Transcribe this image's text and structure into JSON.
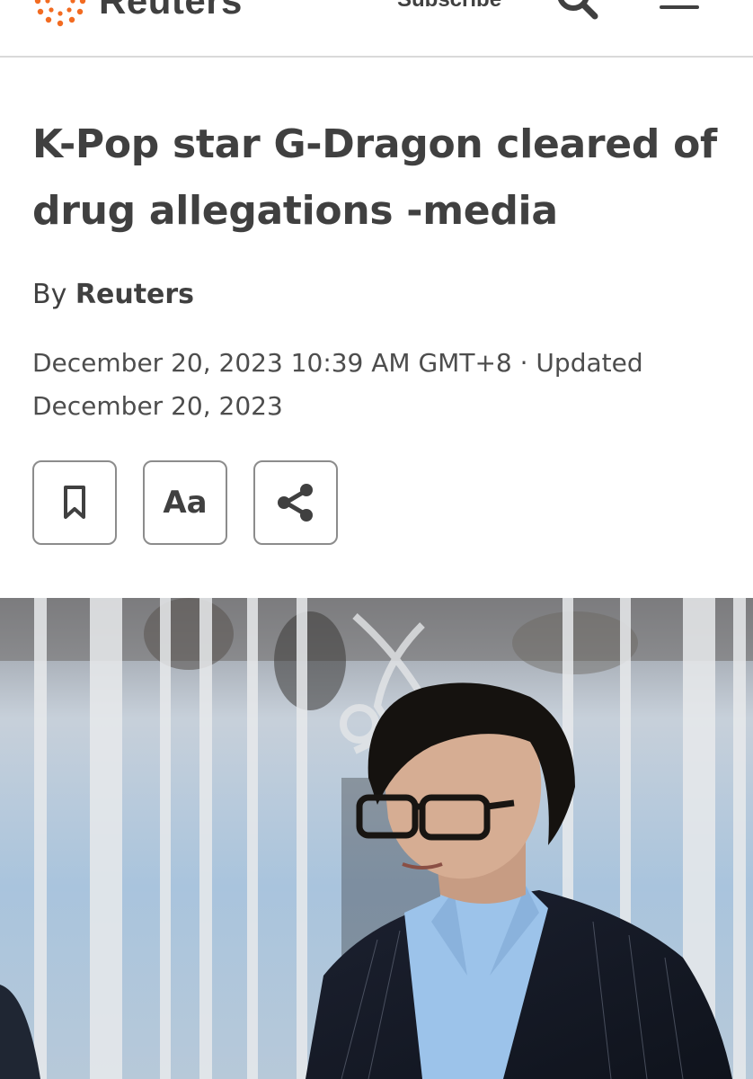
{
  "header": {
    "brand": "Reuters",
    "subscribe_label": "Subscribe",
    "icons": {
      "logo": "reuters-dots-logo",
      "search": "search-icon",
      "menu": "menu-icon"
    },
    "logo_color": "#f26b21"
  },
  "article": {
    "headline": "K-Pop star G-Dragon cleared of drug allegations -media",
    "byline_prefix": "By",
    "author": "Reuters",
    "dateline": "December 20, 2023 10:39 AM GMT+8 · Updated December 20, 2023",
    "actions": [
      {
        "icon": "bookmark-icon"
      },
      {
        "label": "Aa",
        "icon": "font-size-icon"
      },
      {
        "icon": "share-icon"
      }
    ]
  },
  "photo": {
    "subject": "man-with-glasses-photo"
  }
}
